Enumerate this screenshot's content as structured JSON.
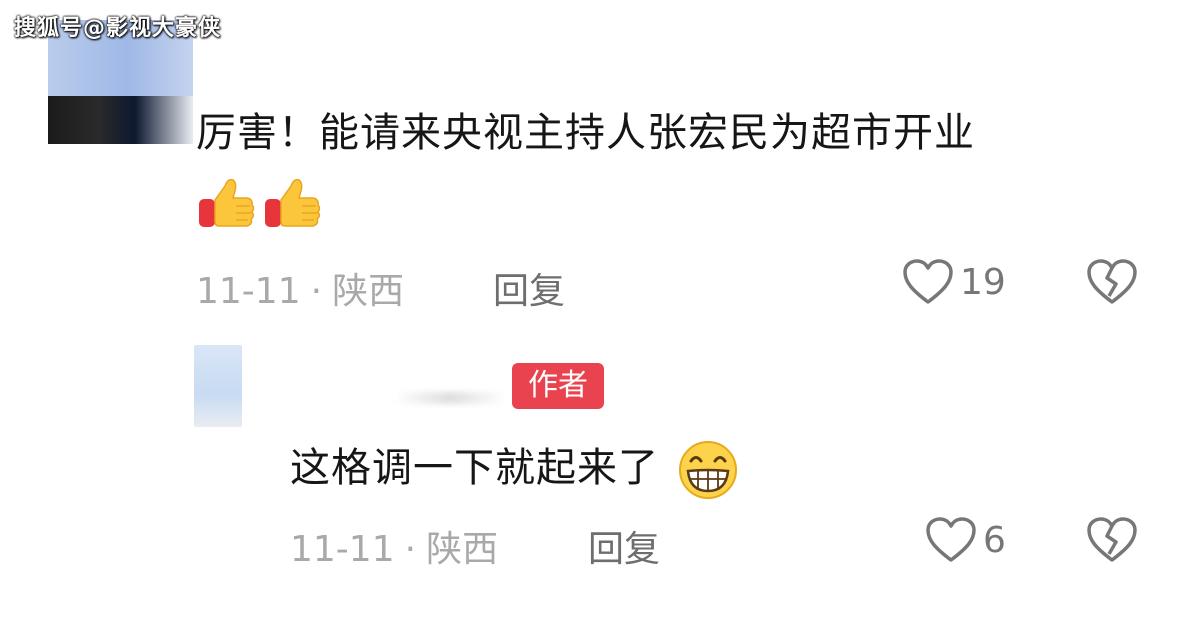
{
  "watermark": "搜狐号@影视大豪侠",
  "comments": [
    {
      "text": "厉害！能请来央视主持人张宏民为超市开业",
      "emojis": [
        "thumbs-up-icon",
        "thumbs-up-icon"
      ],
      "date": "11-11",
      "location": "陕西",
      "reply_label": "回复",
      "likes": "19"
    },
    {
      "badge": "作者",
      "text": "这格调一下就起来了",
      "emojis": [
        "grinning-face-icon"
      ],
      "date": "11-11",
      "location": "陕西",
      "reply_label": "回复",
      "likes": "6"
    }
  ],
  "separator": "·",
  "colors": {
    "badge": "#e94350",
    "meta_text": "#a9a9a9",
    "body_text": "#161616"
  }
}
